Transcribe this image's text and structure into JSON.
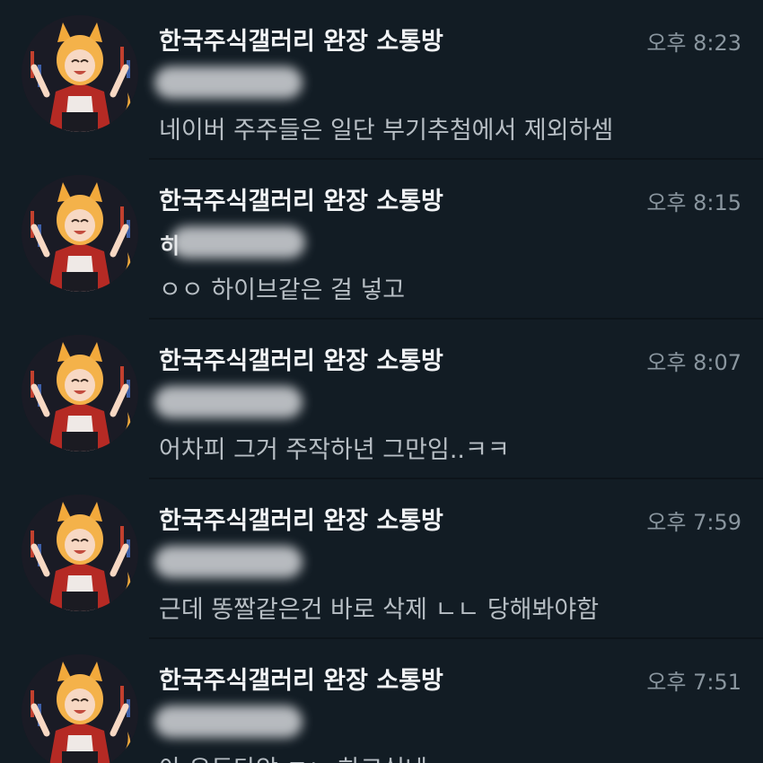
{
  "chats": [
    {
      "title": "한국주식갤러리 완장 소통방",
      "time": "오후 8:23",
      "sender_visible": "",
      "preview": "네이버 주주들은 일단 부기추첨에서 제외하셈"
    },
    {
      "title": "한국주식갤러리 완장 소통방",
      "time": "오후 8:15",
      "sender_visible": "히",
      "preview": "ㅇㅇ 하이브같은 걸 넣고"
    },
    {
      "title": "한국주식갤러리 완장 소통방",
      "time": "오후 8:07",
      "sender_visible": "",
      "preview": "어차피 그거 주작하년 그만임..ㅋㅋ"
    },
    {
      "title": "한국주식갤러리 완장 소통방",
      "time": "오후 7:59",
      "sender_visible": "",
      "preview": "근데 똥짤같은건 바로 삭제 ㄴㄴ 당해봐야함"
    },
    {
      "title": "한국주식갤러리 완장 소통방",
      "time": "오후 7:51",
      "sender_visible": "",
      "preview": "아 유동탄압 ㅈㄴ 하고싶네"
    }
  ],
  "colors": {
    "background": "#121c24",
    "title": "#f2f4f6",
    "time": "#8a969f",
    "preview": "#b7bec4"
  },
  "icons": {
    "avatar": "fox-girl-avatar"
  }
}
